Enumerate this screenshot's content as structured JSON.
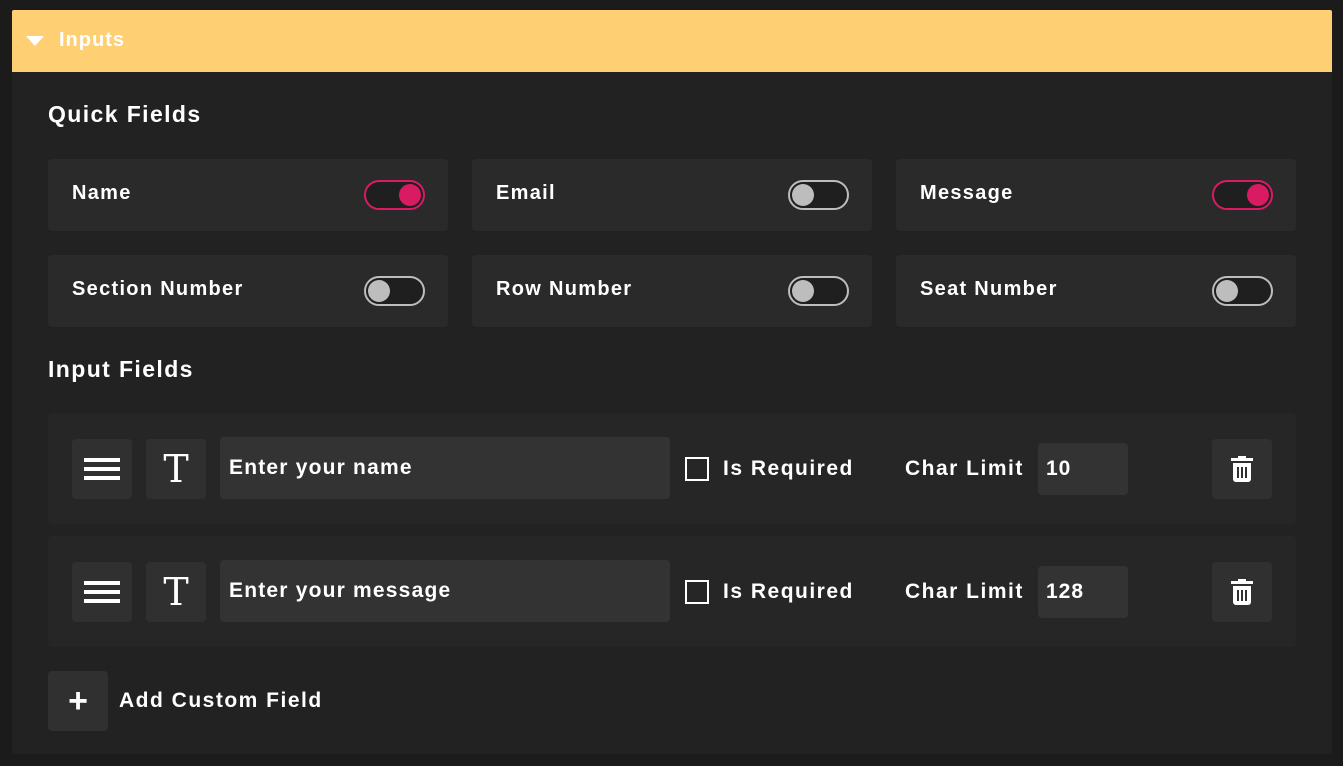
{
  "panel": {
    "title": "Inputs",
    "header_color": "#ffcf73",
    "accent_color": "#d91b64"
  },
  "quick_fields": {
    "title": "Quick Fields",
    "items": [
      {
        "label": "Name",
        "enabled": true
      },
      {
        "label": "Email",
        "enabled": false
      },
      {
        "label": "Message",
        "enabled": true
      },
      {
        "label": "Section Number",
        "enabled": false
      },
      {
        "label": "Row Number",
        "enabled": false
      },
      {
        "label": "Seat Number",
        "enabled": false
      }
    ]
  },
  "input_fields": {
    "title": "Input Fields",
    "rows": [
      {
        "drag_icon": "hamburger-icon",
        "type_icon": "text-type-icon",
        "placeholder": "Enter your name",
        "required_label": "Is Required",
        "required": false,
        "char_limit_label": "Char Limit",
        "char_limit": "10",
        "delete_icon": "trash-icon"
      },
      {
        "drag_icon": "hamburger-icon",
        "type_icon": "text-type-icon",
        "placeholder": "Enter your message",
        "required_label": "Is Required",
        "required": false,
        "char_limit_label": "Char Limit",
        "char_limit": "128",
        "delete_icon": "trash-icon"
      }
    ]
  },
  "add_custom": {
    "label": "Add Custom Field",
    "icon": "plus-icon"
  }
}
